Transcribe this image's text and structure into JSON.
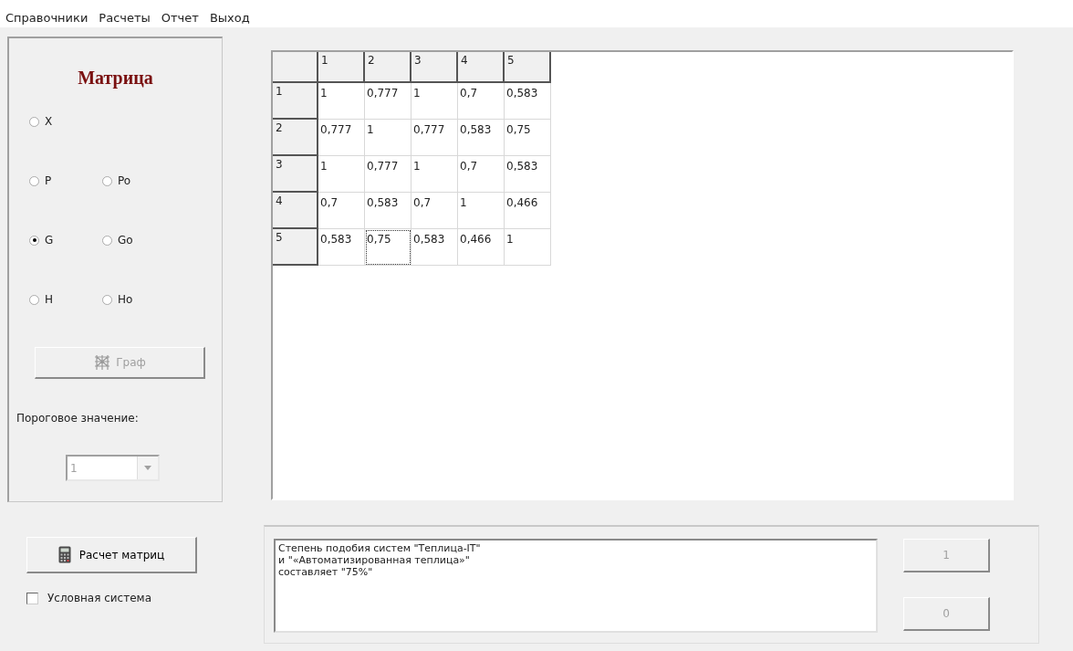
{
  "menu": [
    {
      "label": "Справочники"
    },
    {
      "label": "Расчеты"
    },
    {
      "label": "Отчет"
    },
    {
      "label": "Выход"
    }
  ],
  "matrix_panel": {
    "title": "Матрица",
    "radio_rows": [
      {
        "options": [
          {
            "label": "X",
            "selected": false
          }
        ]
      },
      {
        "options": [
          {
            "label": "P",
            "selected": false
          },
          {
            "label": "Po",
            "selected": false
          }
        ]
      },
      {
        "options": [
          {
            "label": "G",
            "selected": true
          },
          {
            "label": "Go",
            "selected": false
          }
        ]
      },
      {
        "options": [
          {
            "label": "H",
            "selected": false
          },
          {
            "label": "Ho",
            "selected": false
          }
        ]
      }
    ],
    "graph_button": {
      "label": "Граф",
      "disabled": true
    },
    "threshold_label": "Пороговое значение:",
    "threshold_combo": {
      "value": "1",
      "disabled": true
    }
  },
  "calc_button": {
    "label": "Расчет матриц"
  },
  "conditional_system": {
    "label": "Условная система",
    "checked": false
  },
  "table": {
    "columns": [
      "1",
      "2",
      "3",
      "4",
      "5"
    ],
    "rows": [
      {
        "header": "1",
        "cells": [
          {
            "text": "1",
            "focused": false
          },
          {
            "text": "0,777",
            "focused": false
          },
          {
            "text": "1",
            "focused": false
          },
          {
            "text": "0,7",
            "focused": false
          },
          {
            "text": "0,583",
            "focused": false
          }
        ]
      },
      {
        "header": "2",
        "cells": [
          {
            "text": "0,777",
            "focused": false
          },
          {
            "text": "1",
            "focused": false
          },
          {
            "text": "0,777",
            "focused": false
          },
          {
            "text": "0,583",
            "focused": false
          },
          {
            "text": "0,75",
            "focused": false
          }
        ]
      },
      {
        "header": "3",
        "cells": [
          {
            "text": "1",
            "focused": false
          },
          {
            "text": "0,777",
            "focused": false
          },
          {
            "text": "1",
            "focused": false
          },
          {
            "text": "0,7",
            "focused": false
          },
          {
            "text": "0,583",
            "focused": false
          }
        ]
      },
      {
        "header": "4",
        "cells": [
          {
            "text": "0,7",
            "focused": false
          },
          {
            "text": "0,583",
            "focused": false
          },
          {
            "text": "0,7",
            "focused": false
          },
          {
            "text": "1",
            "focused": false
          },
          {
            "text": "0,466",
            "focused": false
          }
        ]
      },
      {
        "header": "5",
        "cells": [
          {
            "text": "0,583",
            "focused": false
          },
          {
            "text": "0,75",
            "focused": true
          },
          {
            "text": "0,583",
            "focused": false
          },
          {
            "text": "0,466",
            "focused": false
          },
          {
            "text": "1",
            "focused": false
          }
        ]
      }
    ]
  },
  "result": {
    "text": "Степень подобия систем \"Теплица-IT\"\nи \"«Автоматизированная теплица»\"\nсоставляет \"75%\"",
    "buttons": [
      {
        "label": "1",
        "disabled": true
      },
      {
        "label": "0",
        "disabled": true
      }
    ]
  }
}
